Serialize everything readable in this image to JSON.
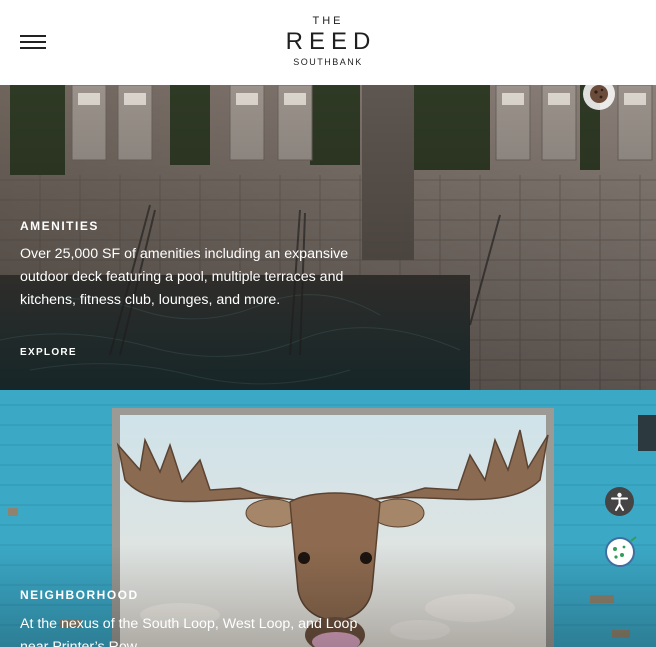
{
  "header": {
    "menu_icon": "hamburger-menu-icon",
    "logo": {
      "line1": "THE",
      "line2": "REED",
      "line3": "SOUTHBANK"
    }
  },
  "amenities": {
    "label": "AMENITIES",
    "description": "Over 25,000 SF of amenities including an expansive outdoor deck featuring a pool, multiple terraces and kitchens, fitness club, lounges, and more.",
    "link": "EXPLORE",
    "image": "aerial-pool-deck-image"
  },
  "neighborhood": {
    "label": "NEIGHBORHOOD",
    "description": "At the nexus of the South Loop, West Loop, and Loop near Printer’s Row.",
    "image": "moose-mural-image"
  },
  "widgets": {
    "accessibility_icon": "accessibility-icon",
    "cookie_icon": "cookie-icon"
  },
  "colors": {
    "header_bg": "#ffffff",
    "text_dark": "#1f1f1f",
    "overlay_text": "#ffffff",
    "mural_blue": "#3aa9c7"
  }
}
